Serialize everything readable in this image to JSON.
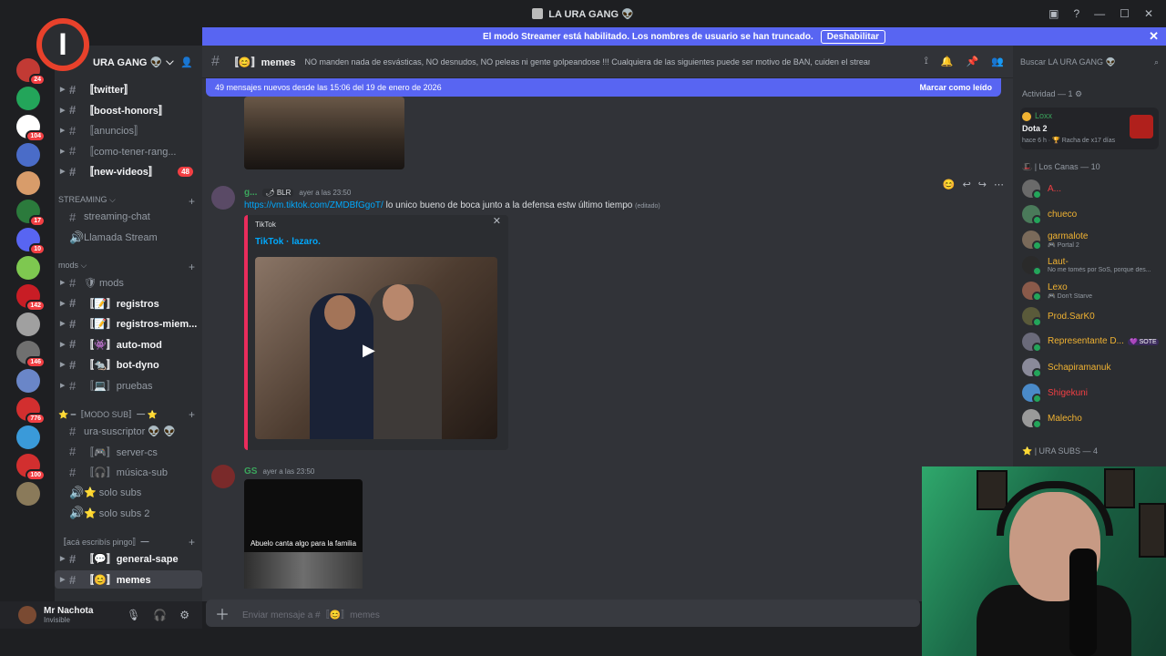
{
  "window": {
    "title": "LA URA GANG 👽"
  },
  "banner": {
    "text": "El modo Streamer está habilitado. Los nombres de usuario se han truncado.",
    "button": "Deshabilitar"
  },
  "server": {
    "name": "URA GANG 👽"
  },
  "servers": [
    {
      "badge": "24",
      "color": "#c23a34"
    },
    {
      "badge": "",
      "color": "#23a55a"
    },
    {
      "badge": "104",
      "color": "#ffffff"
    },
    {
      "badge": "",
      "color": "#4a6cc8"
    },
    {
      "badge": "",
      "color": "#d89c6a"
    },
    {
      "badge": "17",
      "color": "#2b7a3c"
    },
    {
      "badge": "10",
      "color": "#5865f2"
    },
    {
      "badge": "",
      "color": "#7ec850"
    },
    {
      "badge": "142",
      "color": "#c81d25"
    },
    {
      "badge": "",
      "color": "#a0a0a0"
    },
    {
      "badge": "146",
      "color": "#707070"
    },
    {
      "badge": "",
      "color": "#6a86c8"
    },
    {
      "badge": "776",
      "color": "#d22f2f"
    },
    {
      "badge": "",
      "color": "#3a9ad9"
    },
    {
      "badge": "100",
      "color": "#d22f2f"
    },
    {
      "badge": "",
      "color": "#8a7a5a"
    }
  ],
  "channels": [
    {
      "name": "〚twitter〛",
      "bold": true,
      "pre": "» 🌶"
    },
    {
      "name": "〚boost-honors〛",
      "bold": true,
      "pre": "» 💜"
    },
    {
      "name": "〚anuncios〛",
      "bold": false,
      "pre": "» 🐍"
    },
    {
      "name": "〚como-tener-rang...",
      "bold": false,
      "pre": "» ✏"
    },
    {
      "name": "〚new-videos〛",
      "bold": true,
      "pre": "» 📼",
      "pill": "48"
    }
  ],
  "streaming": {
    "label": "STREAMING ⌵",
    "items": [
      "streaming-chat",
      "Llamada Stream"
    ]
  },
  "mods": {
    "label": "mods ⌵",
    "items": [
      {
        "name": "🛡 mods",
        "bold": false
      },
      {
        "name": "〚📝〛registros",
        "bold": true
      },
      {
        "name": "〚📝〛registros-miem...",
        "bold": true
      },
      {
        "name": "〚👾〛auto-mod",
        "bold": true
      },
      {
        "name": "〚🐀〛bot-dyno",
        "bold": true
      },
      {
        "name": "〚💻〛pruebas",
        "bold": false
      }
    ]
  },
  "modosub": {
    "label": "⭐ ━〚MODO SUB〛━ ⭐",
    "items": [
      "ura-suscriptor 👽 👽",
      "〚🎮〛server-cs",
      "〚🎧〛música-sub",
      "⭐ solo subs",
      "⭐ solo subs 2"
    ]
  },
  "aca": {
    "label": "〚acá escribís pingo〛━",
    "items": [
      {
        "name": "〚💬〛general-sape",
        "bold": true
      },
      {
        "name": "〚😊〛memes",
        "bold": true
      }
    ]
  },
  "user": {
    "name": "Mr Nachota",
    "status": "Invisible"
  },
  "header": {
    "channel": "〚😊〛memes",
    "topic": "NO manden nada de esvásticas, NO desnudos, NO peleas ni gente golpeandose !!! Cualquiera de las siguientes puede ser motivo de BAN, cuiden el stream!"
  },
  "search": {
    "placeholder": "Buscar LA URA GANG 👽"
  },
  "newbar": {
    "text": "49 mensajes nuevos desde las 15:06 del 19 de enero de 2026",
    "mark": "Marcar como leído"
  },
  "msg1": {
    "author": "g...",
    "tag": "🌶 BLR",
    "time": "ayer a las 23:50",
    "link": "https://vm.tiktok.com/ZMDBfGgoT/",
    "text": " lo unico bueno de boca junto a la defensa estw último tiempo ",
    "edited": "(editado)",
    "embed_provider": "TikTok",
    "embed_title": "TikTok · lazaro."
  },
  "msg2": {
    "author": "GS",
    "time": "ayer a las 23:50",
    "caption": "Abuelo canta algo para la familia"
  },
  "composer": {
    "placeholder": "Enviar mensaje a #〚😊〛memes"
  },
  "members": {
    "activity_header": "Actividad — 1 ⚙",
    "activity": {
      "name": "Loxx",
      "game": "Dota 2",
      "time": "hace 6 h · 🏆 Racha de x17 días"
    },
    "section1": "🎩 | Los Canas — 10",
    "list": [
      {
        "name": "A...",
        "color": "#f23f43",
        "status": ""
      },
      {
        "name": "chueco",
        "color": "#f0b232",
        "status": ""
      },
      {
        "name": "garmalote",
        "color": "#f0b232",
        "status": "🎮 Portal 2"
      },
      {
        "name": "Laut-",
        "color": "#f0b232",
        "status": "No me tomés por SoS, porque des..."
      },
      {
        "name": "Lexo",
        "color": "#f0b232",
        "status": "🎮 Don't Starve"
      },
      {
        "name": "Prod.SarK0",
        "color": "#f0b232",
        "status": ""
      },
      {
        "name": "Representante D...",
        "color": "#f0b232",
        "status": "",
        "tag": "💜 SOTE"
      },
      {
        "name": "Schapiramanuk",
        "color": "#f0b232",
        "status": ""
      },
      {
        "name": "Shigekuni",
        "color": "#f23f43",
        "status": ""
      },
      {
        "name": "Malecho",
        "color": "#f0b232",
        "status": ""
      }
    ],
    "section2": "⭐ | URA SUBS — 4"
  },
  "colors": {
    "accent": "#5865f2",
    "bg": "#313338",
    "sidebar": "#2b2d31",
    "rail": "#1e1f22",
    "tiktok": "#ea2c5c",
    "online": "#23a55a"
  }
}
